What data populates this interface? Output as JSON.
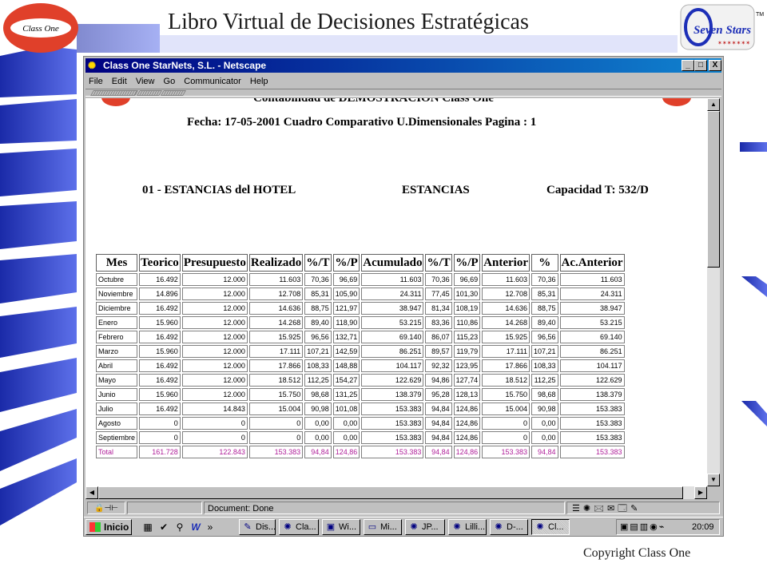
{
  "slide": {
    "title": "Libro Virtual de Decisiones Estratégicas",
    "logo_left_text": "Class One",
    "logo_right_text": "Seven Stars",
    "logo_right_tm": "TM",
    "copyright": "Copyright Class One"
  },
  "window": {
    "title": "Class One StarNets, S.L. - Netscape",
    "menu": [
      "File",
      "Edit",
      "View",
      "Go",
      "Communicator",
      "Help"
    ],
    "controls": [
      "_",
      "□",
      "X"
    ]
  },
  "report": {
    "header_cut": "Contabilidad de DEMOSTRACION Class One",
    "date_line": "Fecha: 17-05-2001 Cuadro Comparativo U.Dimensionales Pagina : 1",
    "section": "01 - ESTANCIAS del HOTEL",
    "unit": "ESTANCIAS",
    "capacity": "Capacidad T: 532/D"
  },
  "table": {
    "headers": [
      "Mes",
      "Teorico",
      "Presupuesto",
      "Realizado",
      "%/T",
      "%/P",
      "Acumulado",
      "%/T",
      "%/P",
      "Anterior",
      "%",
      "Ac.Anterior"
    ],
    "rows": [
      [
        "Octubre",
        "16.492",
        "12.000",
        "11.603",
        "70,36",
        "96,69",
        "11.603",
        "70,36",
        "96,69",
        "11.603",
        "70,36",
        "11.603"
      ],
      [
        "Noviembre",
        "14.896",
        "12.000",
        "12.708",
        "85,31",
        "105,90",
        "24.311",
        "77,45",
        "101,30",
        "12.708",
        "85,31",
        "24.311"
      ],
      [
        "Diciembre",
        "16.492",
        "12.000",
        "14.636",
        "88,75",
        "121,97",
        "38.947",
        "81,34",
        "108,19",
        "14.636",
        "88,75",
        "38.947"
      ],
      [
        "Enero",
        "15.960",
        "12.000",
        "14.268",
        "89,40",
        "118,90",
        "53.215",
        "83,36",
        "110,86",
        "14.268",
        "89,40",
        "53.215"
      ],
      [
        "Febrero",
        "16.492",
        "12.000",
        "15.925",
        "96,56",
        "132,71",
        "69.140",
        "86,07",
        "115,23",
        "15.925",
        "96,56",
        "69.140"
      ],
      [
        "Marzo",
        "15.960",
        "12.000",
        "17.111",
        "107,21",
        "142,59",
        "86.251",
        "89,57",
        "119,79",
        "17.111",
        "107,21",
        "86.251"
      ],
      [
        "Abril",
        "16.492",
        "12.000",
        "17.866",
        "108,33",
        "148,88",
        "104.117",
        "92,32",
        "123,95",
        "17.866",
        "108,33",
        "104.117"
      ],
      [
        "Mayo",
        "16.492",
        "12.000",
        "18.512",
        "112,25",
        "154,27",
        "122.629",
        "94,86",
        "127,74",
        "18.512",
        "112,25",
        "122.629"
      ],
      [
        "Junio",
        "15.960",
        "12.000",
        "15.750",
        "98,68",
        "131,25",
        "138.379",
        "95,28",
        "128,13",
        "15.750",
        "98,68",
        "138.379"
      ],
      [
        "Julio",
        "16.492",
        "14.843",
        "15.004",
        "90,98",
        "101,08",
        "153.383",
        "94,84",
        "124,86",
        "15.004",
        "90,98",
        "153.383"
      ],
      [
        "Agosto",
        "0",
        "0",
        "0",
        "0,00",
        "0,00",
        "153.383",
        "94,84",
        "124,86",
        "0",
        "0,00",
        "153.383"
      ],
      [
        "Septiembre",
        "0",
        "0",
        "0",
        "0,00",
        "0,00",
        "153.383",
        "94,84",
        "124,86",
        "0",
        "0,00",
        "153.383"
      ],
      [
        "Total",
        "161.728",
        "122.843",
        "153.383",
        "94,84",
        "124,86",
        "153.383",
        "94,84",
        "124,86",
        "153.383",
        "94,84",
        "153.383"
      ]
    ]
  },
  "statusbar": {
    "text": "Document: Done"
  },
  "taskbar": {
    "start_label": "Inicio",
    "quick_more": "»",
    "tasks": [
      {
        "label": "Dis...",
        "icon": "presentation-icon"
      },
      {
        "label": "Cla...",
        "icon": "netscape-icon"
      },
      {
        "label": "Wi...",
        "icon": "disk-icon"
      },
      {
        "label": "Mi...",
        "icon": "window-icon"
      },
      {
        "label": "JP...",
        "icon": "netscape-icon"
      },
      {
        "label": "Lilli...",
        "icon": "netscape-icon"
      },
      {
        "label": "D-...",
        "icon": "netscape-icon"
      },
      {
        "label": "Cl...",
        "icon": "netscape-icon"
      }
    ],
    "clock": "20:09"
  },
  "colors": {
    "accent_blue": "#1d2fb7",
    "titlebar": "#000080",
    "total_row": "#b0209a",
    "logo_red": "#e0402a"
  }
}
